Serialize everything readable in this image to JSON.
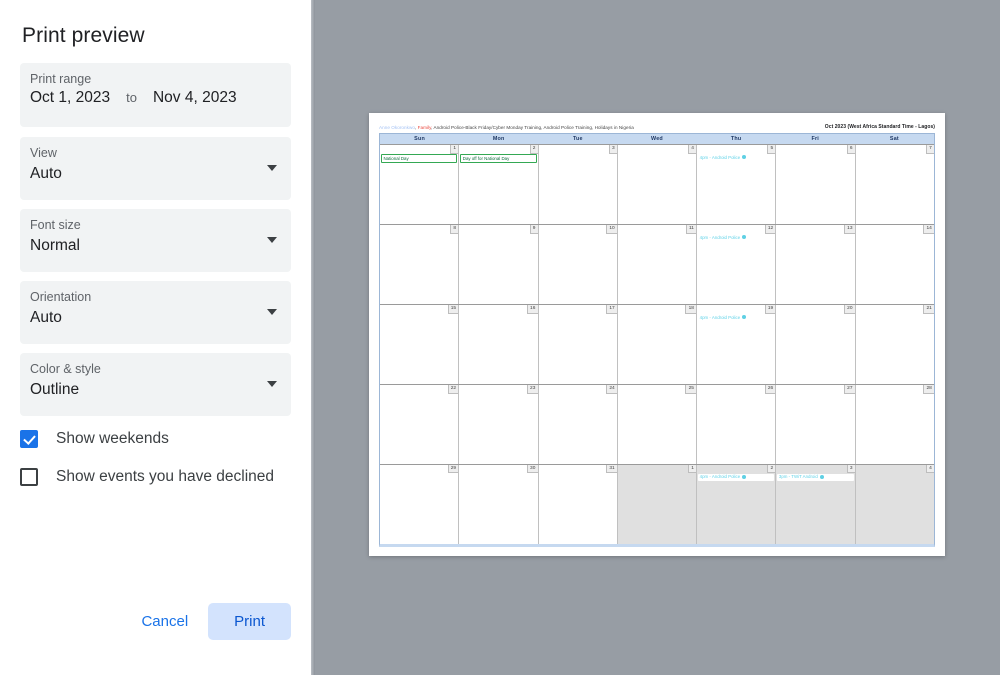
{
  "panel": {
    "title": "Print preview",
    "fields": {
      "print_range": {
        "label": "Print range",
        "start": "Oct 1, 2023",
        "separator": "to",
        "end": "Nov 4, 2023"
      },
      "view": {
        "label": "View",
        "value": "Auto"
      },
      "font_size": {
        "label": "Font size",
        "value": "Normal"
      },
      "orientation": {
        "label": "Orientation",
        "value": "Auto"
      },
      "color_style": {
        "label": "Color & style",
        "value": "Outline"
      }
    },
    "checkboxes": [
      {
        "label": "Show weekends",
        "checked": true
      },
      {
        "label": "Show events you have declined",
        "checked": false
      }
    ],
    "actions": {
      "cancel": "Cancel",
      "print": "Print"
    }
  },
  "preview": {
    "legend": [
      {
        "text": "Anne Okoronkwo",
        "color": "#a4c2f4"
      },
      {
        "text": ", ",
        "color": "#444444"
      },
      {
        "text": "Family",
        "color": "#e8453c"
      },
      {
        "text": ", Android Police-Black Friday/Cyber Monday Training, Android Police Training, Holidays in Nigeria",
        "color": "#444444"
      }
    ],
    "title": "Oct 2023 (West Africa Standard Time - Lagos)",
    "day_headers": [
      "Sun",
      "Mon",
      "Tue",
      "Wed",
      "Thu",
      "Fri",
      "Sat"
    ],
    "weeks": [
      [
        {
          "num": "1",
          "other": false,
          "events": [
            {
              "text": "National Day",
              "type": "holiday"
            }
          ]
        },
        {
          "num": "2",
          "other": false,
          "events": [
            {
              "text": "Day off for National Day",
              "type": "holiday"
            }
          ]
        },
        {
          "num": "3",
          "other": false,
          "events": []
        },
        {
          "num": "4",
          "other": false,
          "events": []
        },
        {
          "num": "5",
          "other": false,
          "events": [
            {
              "text": "4pm - Android Police",
              "type": "timed"
            }
          ]
        },
        {
          "num": "6",
          "other": false,
          "events": []
        },
        {
          "num": "7",
          "other": false,
          "events": []
        }
      ],
      [
        {
          "num": "8",
          "other": false,
          "events": []
        },
        {
          "num": "9",
          "other": false,
          "events": []
        },
        {
          "num": "10",
          "other": false,
          "events": []
        },
        {
          "num": "11",
          "other": false,
          "events": []
        },
        {
          "num": "12",
          "other": false,
          "events": [
            {
              "text": "4pm - Android Police",
              "type": "timed"
            }
          ]
        },
        {
          "num": "13",
          "other": false,
          "events": []
        },
        {
          "num": "14",
          "other": false,
          "events": []
        }
      ],
      [
        {
          "num": "15",
          "other": false,
          "events": []
        },
        {
          "num": "16",
          "other": false,
          "events": []
        },
        {
          "num": "17",
          "other": false,
          "events": []
        },
        {
          "num": "18",
          "other": false,
          "events": []
        },
        {
          "num": "19",
          "other": false,
          "events": [
            {
              "text": "4pm - Android Police",
              "type": "timed"
            }
          ]
        },
        {
          "num": "20",
          "other": false,
          "events": []
        },
        {
          "num": "21",
          "other": false,
          "events": []
        }
      ],
      [
        {
          "num": "22",
          "other": false,
          "events": []
        },
        {
          "num": "23",
          "other": false,
          "events": []
        },
        {
          "num": "24",
          "other": false,
          "events": []
        },
        {
          "num": "25",
          "other": false,
          "events": []
        },
        {
          "num": "26",
          "other": false,
          "events": []
        },
        {
          "num": "27",
          "other": false,
          "events": []
        },
        {
          "num": "28",
          "other": false,
          "events": []
        }
      ],
      [
        {
          "num": "29",
          "other": false,
          "events": []
        },
        {
          "num": "30",
          "other": false,
          "events": []
        },
        {
          "num": "31",
          "other": false,
          "events": []
        },
        {
          "num": "1",
          "other": true,
          "events": []
        },
        {
          "num": "2",
          "other": true,
          "events": [
            {
              "text": "4pm - Android Police",
              "type": "timed"
            }
          ]
        },
        {
          "num": "3",
          "other": true,
          "events": [
            {
              "text": "3pm - TWiT Android",
              "type": "timed"
            }
          ]
        },
        {
          "num": "4",
          "other": true,
          "events": []
        }
      ]
    ]
  },
  "colors": {
    "accent": "#1a73e8",
    "print_button_bg": "#d3e3fd",
    "holiday_green": "#34a853",
    "event_cyan": "#63d3e8",
    "backdrop": "#979da4"
  }
}
